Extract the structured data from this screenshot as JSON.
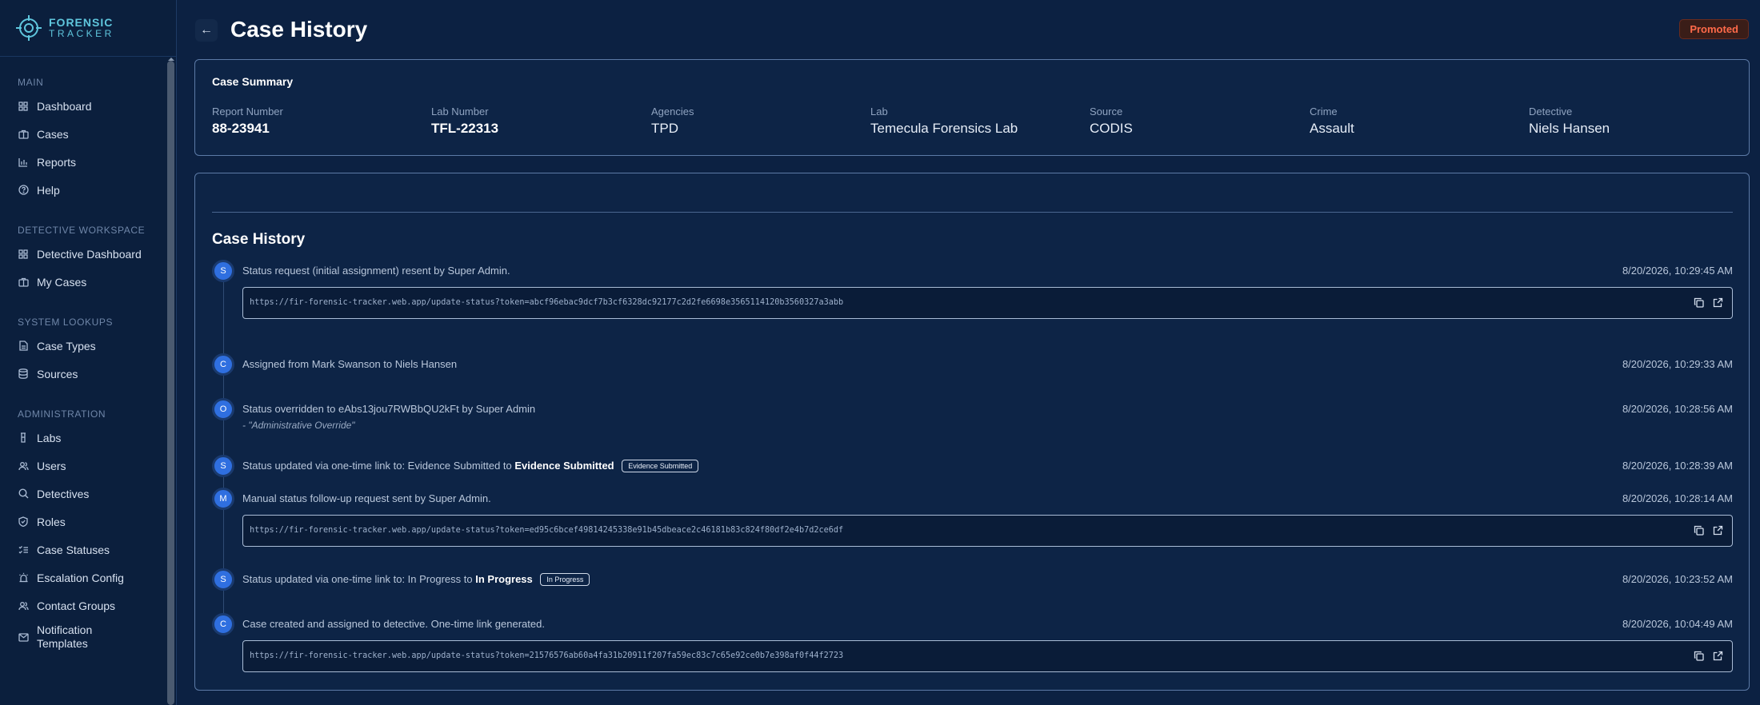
{
  "brand": {
    "line1": "FORENSIC",
    "line2": "TRACKER"
  },
  "nav": {
    "main_header": "MAIN",
    "main": [
      {
        "label": "Dashboard",
        "icon": "grid-icon"
      },
      {
        "label": "Cases",
        "icon": "briefcase-icon"
      },
      {
        "label": "Reports",
        "icon": "bar-chart-icon"
      },
      {
        "label": "Help",
        "icon": "help-circle-icon"
      }
    ],
    "detective_header": "DETECTIVE WORKSPACE",
    "detective": [
      {
        "label": "Detective Dashboard",
        "icon": "grid-icon"
      },
      {
        "label": "My Cases",
        "icon": "briefcase-icon"
      }
    ],
    "lookups_header": "SYSTEM LOOKUPS",
    "lookups": [
      {
        "label": "Case Types",
        "icon": "file-icon"
      },
      {
        "label": "Sources",
        "icon": "database-icon"
      }
    ],
    "admin_header": "ADMINISTRATION",
    "admin": [
      {
        "label": "Labs",
        "icon": "flask-icon"
      },
      {
        "label": "Users",
        "icon": "users-icon"
      },
      {
        "label": "Detectives",
        "icon": "search-icon"
      },
      {
        "label": "Roles",
        "icon": "shield-icon"
      },
      {
        "label": "Case Statuses",
        "icon": "list-check-icon"
      },
      {
        "label": "Escalation Config",
        "icon": "siren-icon"
      },
      {
        "label": "Contact Groups",
        "icon": "users-icon"
      },
      {
        "label": "Notification Templates",
        "icon": "mail-icon"
      }
    ]
  },
  "header": {
    "title": "Case History",
    "status_badge": "Promoted"
  },
  "summary": {
    "title": "Case Summary",
    "fields": [
      {
        "label": "Report Number",
        "value": "88-23941"
      },
      {
        "label": "Lab Number",
        "value": "TFL-22313"
      },
      {
        "label": "Agencies",
        "value": "TPD"
      },
      {
        "label": "Lab",
        "value": "Temecula Forensics Lab"
      },
      {
        "label": "Source",
        "value": "CODIS"
      },
      {
        "label": "Crime",
        "value": "Assault"
      },
      {
        "label": "Detective",
        "value": "Niels Hansen"
      }
    ]
  },
  "history": {
    "title": "Case History",
    "events": [
      {
        "initial": "S",
        "text": "Status request (initial assignment) resent by Super Admin.",
        "time": "8/20/2026, 10:29:45 AM",
        "link": "https://fir-forensic-tracker.web.app/update-status?token=abcf96ebac9dcf7b3cf6328dc92177c2d2fe6698e3565114120b3560327a3abb"
      },
      {
        "initial": "C",
        "text": "Assigned from Mark Swanson to Niels Hansen",
        "time": "8/20/2026, 10:29:33 AM"
      },
      {
        "initial": "O",
        "text": "Status overridden to eAbs13jou7RWBbQU2kFt by Super Admin",
        "note": "- \"Administrative Override\"",
        "time": "8/20/2026, 10:28:56 AM"
      },
      {
        "initial": "S",
        "text": "Status updated via one-time link to: Evidence Submitted  to",
        "strong": "Evidence Submitted",
        "badge": "Evidence Submitted",
        "time": "8/20/2026, 10:28:39 AM"
      },
      {
        "initial": "M",
        "text": "Manual status follow-up request sent by Super Admin.",
        "time": "8/20/2026, 10:28:14 AM",
        "link": "https://fir-forensic-tracker.web.app/update-status?token=ed95c6bcef49814245338e91b45dbeace2c46181b83c824f80df2e4b7d2ce6df"
      },
      {
        "initial": "S",
        "text": "Status updated via one-time link to: In Progress  to",
        "strong": "In Progress",
        "badge": "In Progress",
        "time": "8/20/2026, 10:23:52 AM"
      },
      {
        "initial": "C",
        "text": "Case created and assigned to detective. One-time link generated.",
        "time": "8/20/2026, 10:04:49 AM",
        "link": "https://fir-forensic-tracker.web.app/update-status?token=21576576ab60a4fa31b20911f207fa59ec83c7c65e92ce0b7e398af0f44f2723"
      }
    ]
  },
  "colors": {
    "background": "#0c2142",
    "accent": "#2f6fe0",
    "promoted": "#ff6a4a"
  }
}
